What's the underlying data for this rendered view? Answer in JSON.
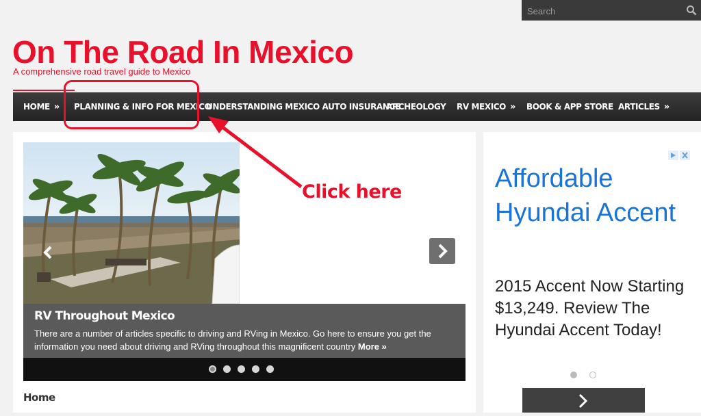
{
  "search": {
    "placeholder": "Search"
  },
  "site": {
    "title": "On The Road In Mexico",
    "tagline": "A comprehensive road travel guide to Mexico"
  },
  "nav": {
    "items": [
      {
        "label": "HOME",
        "has_arrow": true,
        "arrow": "»"
      },
      {
        "label": "PLANNING & INFO FOR MEXICO",
        "has_arrow": false
      },
      {
        "label": "UNDERSTANDING MEXICO AUTO INSURANCE",
        "has_arrow": false
      },
      {
        "label": "ARCHEOLOGY",
        "has_arrow": false
      },
      {
        "label": "RV MEXICO",
        "has_arrow": true,
        "arrow": "»"
      },
      {
        "label": "BOOK & APP STORE",
        "has_arrow": false
      },
      {
        "label": "ARTICLES",
        "has_arrow": true,
        "arrow": "»"
      }
    ]
  },
  "slider": {
    "caption_title": "RV Throughout Mexico",
    "caption_text": "There are a number of articles specific to driving and RVing in Mexico. Go here to ensure you get the information you need about driving and RVing throughout this magnificent country",
    "more_label": "More »",
    "dots_count": 5,
    "active_dot": 1
  },
  "breadcrumb": {
    "home": "Home"
  },
  "ad": {
    "headline": "Affordable Hyundai Accent",
    "body": "2015 Accent Now Starting $13,249. Review The Hyundai Accent Today!",
    "headline_color": "#1a73d6"
  },
  "annotation": {
    "text": "Click here",
    "color": "#e8102a"
  },
  "colors": {
    "brand_red": "#e8102a",
    "nav_bg": "#2e2e2e"
  }
}
